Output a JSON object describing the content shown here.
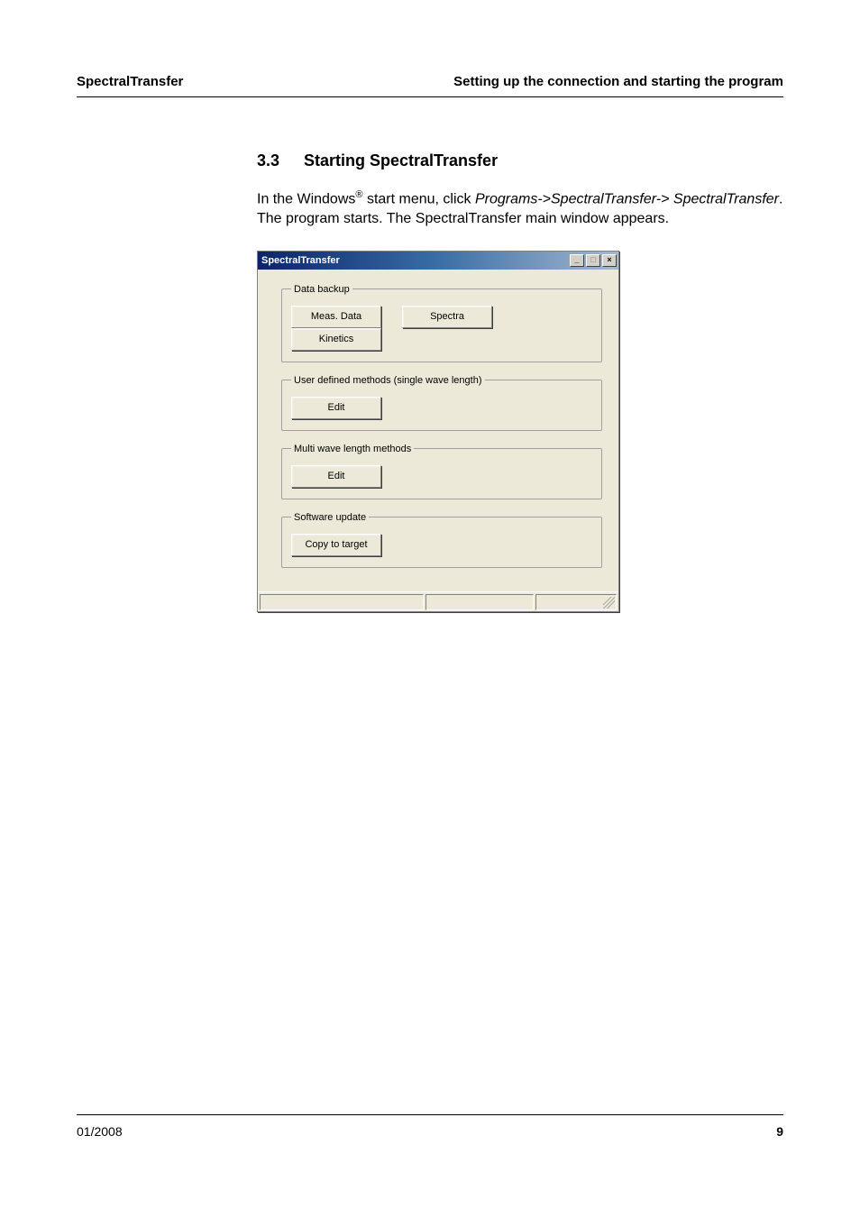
{
  "header": {
    "left": "SpectralTransfer",
    "right": "Setting up the connection and starting the program"
  },
  "section": {
    "number": "3.3",
    "title": "Starting SpectralTransfer"
  },
  "paragraph": {
    "pre": "In the Windows",
    "reg": "®",
    "mid": " start menu, click ",
    "path1": "Programs->SpectralTransfer-> SpectralTransfer",
    "post": ". The program starts. The SpectralTransfer main window appears."
  },
  "window": {
    "title": "SpectralTransfer",
    "controls": {
      "min": "_",
      "max": "□",
      "close": "×"
    },
    "groups": {
      "backup": {
        "legend": "Data backup",
        "buttons": {
          "meas": "Meas. Data",
          "spectra": "Spectra",
          "kinetics": "Kinetics"
        }
      },
      "single": {
        "legend": "User defined methods (single wave length)",
        "buttons": {
          "edit": "Edit"
        }
      },
      "multi": {
        "legend": "Multi wave length methods",
        "buttons": {
          "edit": "Edit"
        }
      },
      "update": {
        "legend": "Software update",
        "buttons": {
          "copy": "Copy to target"
        }
      }
    }
  },
  "footer": {
    "date": "01/2008",
    "page": "9"
  }
}
